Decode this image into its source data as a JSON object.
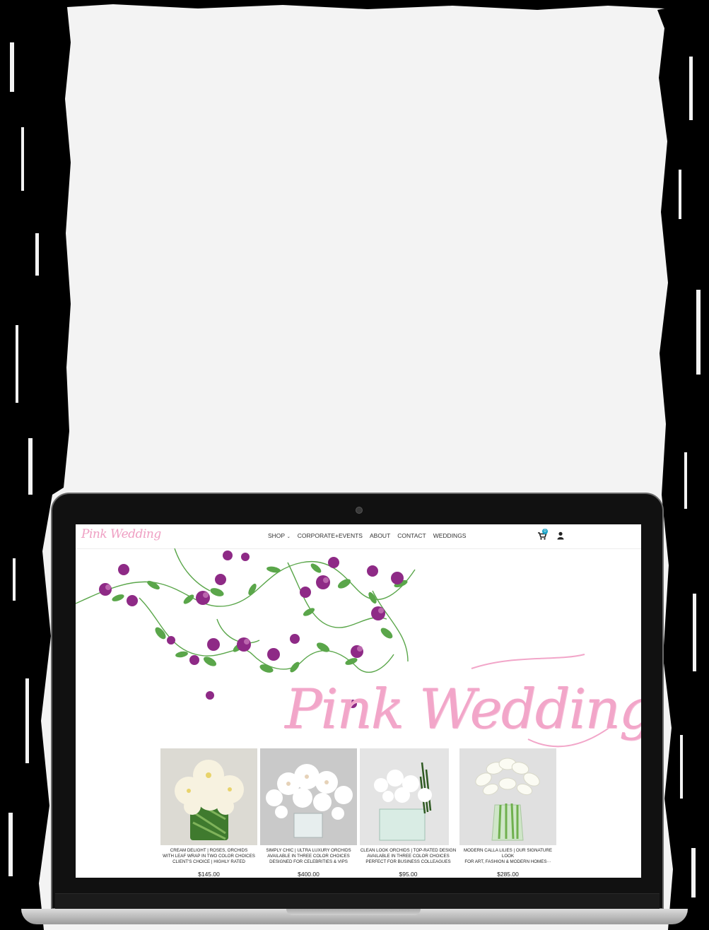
{
  "site": {
    "logo_text": "Pink Wedding",
    "hero_title": "Pink Wedding"
  },
  "nav": {
    "items": [
      {
        "label": "SHOP",
        "has_dropdown": true
      },
      {
        "label": "CORPORATE+EVENTS"
      },
      {
        "label": "ABOUT"
      },
      {
        "label": "CONTACT"
      },
      {
        "label": "WEDDINGS"
      }
    ],
    "cart_count": "0",
    "cart_icon": "shopping-cart-icon",
    "user_icon": "user-icon"
  },
  "products": [
    {
      "lines": [
        "CREAM DELIGHT | ROSES, ORCHIDS",
        "WITH LEAF WRAP IN TWO COLOR CHOICES",
        "CLIENT'S CHOICE | HIGHLY RATED"
      ],
      "price": "$145.00"
    },
    {
      "lines": [
        "SIMPLY CHIC | ULTRA LUXURY ORCHIDS",
        "AVAILABLE IN THREE COLOR CHOICES",
        "DESIGNED FOR CELEBRITIES & VIPS"
      ],
      "price": "$400.00"
    },
    {
      "lines": [
        "CLEAN LOOK ORCHIDS | TOP-RATED DESIGN",
        "AVAILABLE IN THREE COLOR CHOICES",
        "PERFECT FOR BUSINESS COLLEAGUES"
      ],
      "price": "$95.00"
    },
    {
      "lines": [
        "MODERN CALLA LILIES | OUR SIGNATURE",
        "LOOK",
        "FOR ART, FASHION & MODERN HOMES···"
      ],
      "price": "$285.00"
    }
  ],
  "colors": {
    "brand_pink": "#f2a6c9",
    "badge_blue": "#1aa3c6",
    "flower_purple": "#8e2a86",
    "leaf_green": "#5aa64a"
  }
}
